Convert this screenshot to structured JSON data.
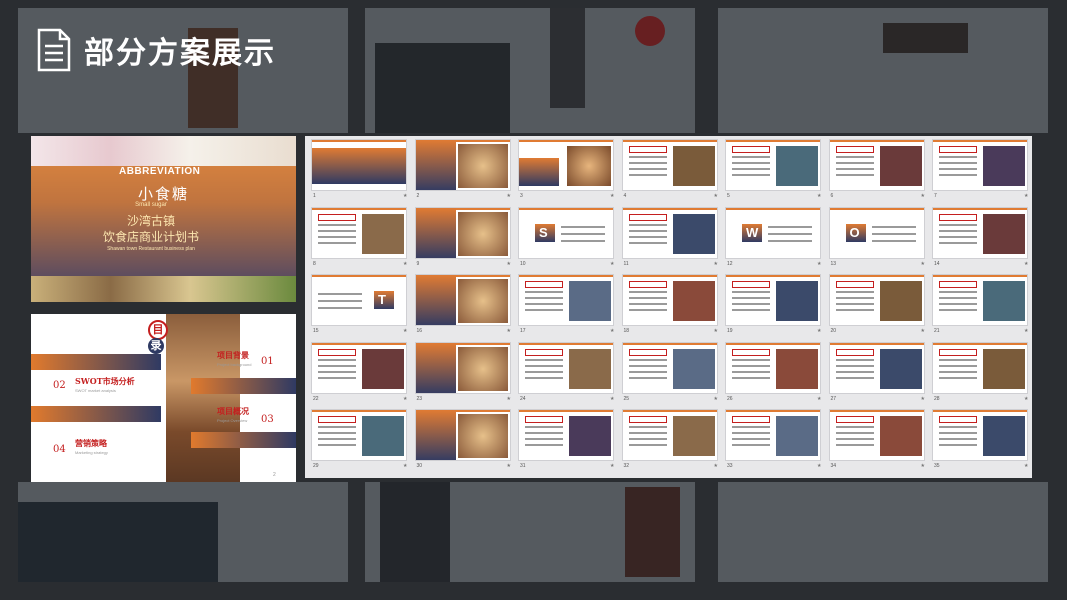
{
  "header": {
    "title": "部分方案展示",
    "icon": "document-icon"
  },
  "cover": {
    "abbr": "ABBREVIATION",
    "name": "小食糖",
    "name_en": "Small sugar",
    "line1": "沙湾古镇",
    "line2": "饮食店商业计划书",
    "line3": "Shawan town Restaurant business plan"
  },
  "toc": {
    "mu": "目",
    "lu": "录",
    "items": [
      {
        "num": "01",
        "title": "项目背景",
        "sub": "Project background"
      },
      {
        "num": "02",
        "title": "SWOT市场分析",
        "sub": "SWOT market analysis"
      },
      {
        "num": "03",
        "title": "项目概况",
        "sub": "Project Overview"
      },
      {
        "num": "04",
        "title": "营销策略",
        "sub": "Marketing strategy"
      }
    ],
    "page": "2"
  },
  "grid": {
    "slide_numbers": [
      "1",
      "2",
      "3",
      "4",
      "5",
      "6",
      "7",
      "8",
      "9",
      "10",
      "11",
      "12",
      "13",
      "14",
      "15",
      "16",
      "17",
      "18",
      "19",
      "20",
      "21",
      "22",
      "23",
      "24",
      "25",
      "26",
      "27",
      "28",
      "29",
      "30",
      "31",
      "32",
      "33",
      "34",
      "35"
    ],
    "letters": {
      "s10": "S",
      "s12": "W",
      "s13": "O",
      "s15": "T"
    },
    "slide_labels": {
      "s9": "02",
      "s3": "01",
      "s16": "03",
      "s30": "04"
    },
    "marker": "★"
  }
}
